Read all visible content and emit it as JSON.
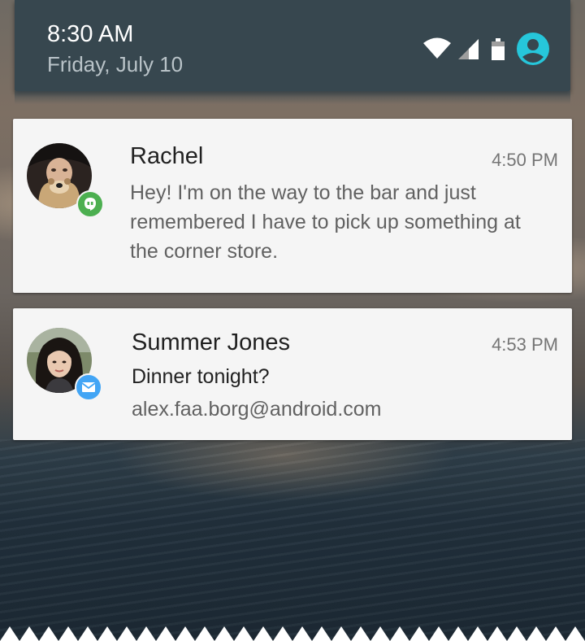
{
  "status_bar": {
    "time": "8:30 AM",
    "date": "Friday, July 10",
    "icons": [
      "wifi-icon",
      "cell-signal-icon",
      "battery-icon",
      "account-icon"
    ]
  },
  "notifications": [
    {
      "sender": "Rachel",
      "time": "4:50 PM",
      "message": "Hey! I'm on the way to the bar and just remembered I have to pick up something at the corner store.",
      "app_badge": "hangouts-icon",
      "badge_color": "#4caf50"
    },
    {
      "sender": "Summer Jones",
      "time": "4:53 PM",
      "subject": "Dinner tonight?",
      "account": "alex.faa.borg@android.com",
      "app_badge": "email-icon",
      "badge_color": "#42a5f5"
    }
  ],
  "colors": {
    "shade": "#37474f",
    "card": "#f5f5f5",
    "account_accent": "#26c6da"
  }
}
